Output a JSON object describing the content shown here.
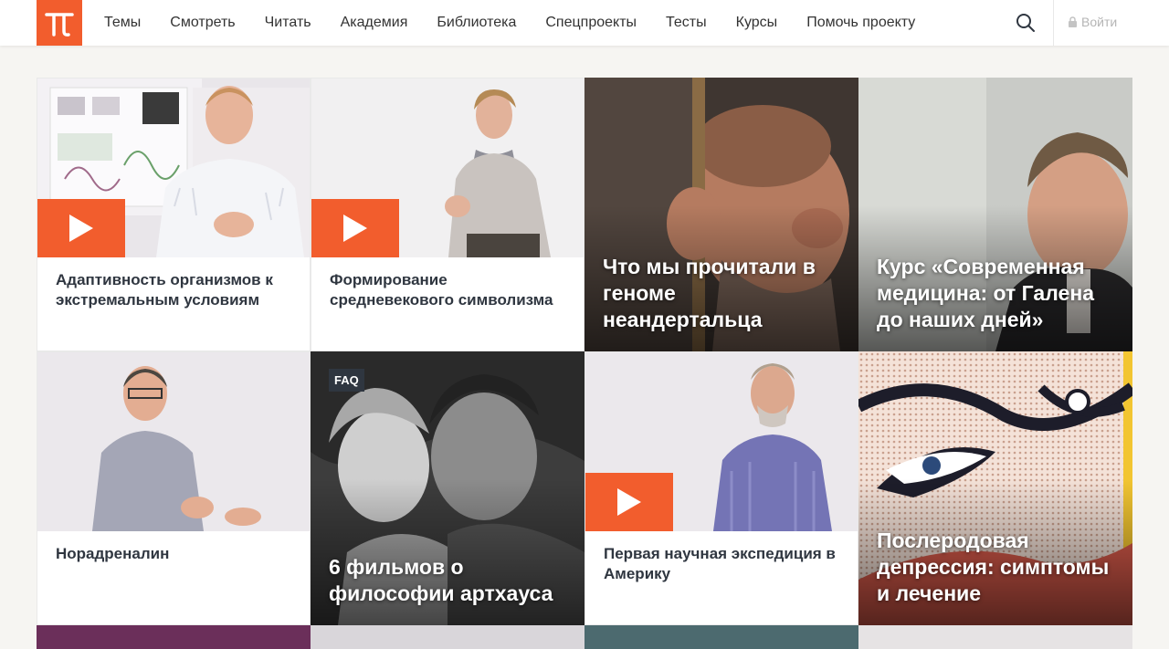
{
  "header": {
    "logo_alt": "π",
    "nav": [
      "Темы",
      "Смотреть",
      "Читать",
      "Академия",
      "Библиотека",
      "Спецпроекты",
      "Тесты",
      "Курсы",
      "Помочь проекту"
    ],
    "login_label": "Войти"
  },
  "colors": {
    "accent": "#f25d2d",
    "dark": "#2f3640"
  },
  "cards": [
    {
      "title": "Адаптивность организмов к экстремальным условиям",
      "type": "video"
    },
    {
      "title": "Формирование средневекового символизма",
      "type": "video"
    },
    {
      "title": "Что мы прочитали в геноме неандертальца",
      "type": "article"
    },
    {
      "title": "Курс «Современная медицина: от Галена до наших дней»",
      "type": "course"
    },
    {
      "title": "Норадреналин",
      "type": "video"
    },
    {
      "title": "6 фильмов о философии артхауса",
      "type": "faq",
      "badge": "FAQ"
    },
    {
      "title": "Первая научная экспедиция в Америку",
      "type": "video"
    },
    {
      "title": "Послеродовая депрессия: симптомы и лечение",
      "type": "article"
    }
  ]
}
